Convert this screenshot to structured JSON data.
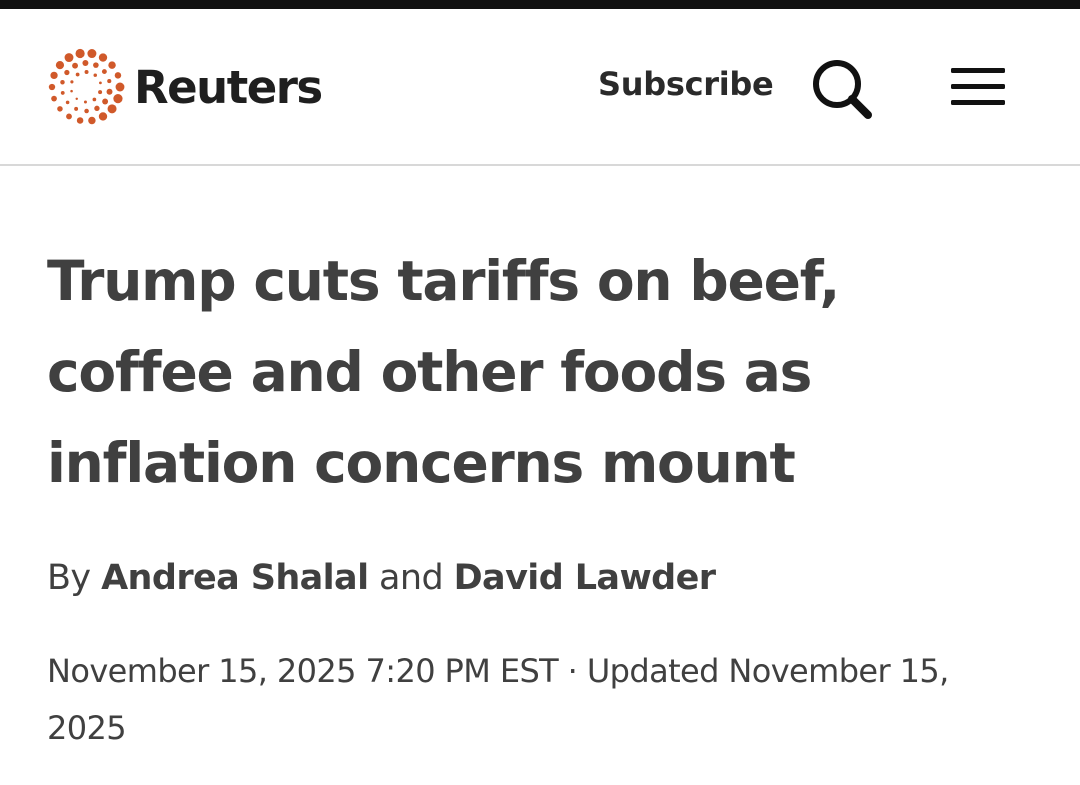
{
  "header": {
    "brand": "Reuters",
    "subscribe_label": "Subscribe",
    "icons": {
      "logo": "reuters-dot-ring-icon",
      "search": "search-icon",
      "menu": "hamburger-menu-icon"
    },
    "colors": {
      "brand_orange": "#d0592a",
      "text_dark": "#1f1f1f",
      "top_bar": "#111111"
    }
  },
  "article": {
    "headline": "Trump cuts tariffs on beef, coffee and other foods as inflation concerns mount",
    "byline": {
      "prefix": "By",
      "author_1": "Andrea Shalal",
      "conjunction": "and",
      "author_2": "David Lawder"
    },
    "dateline": "November 15, 2025 7:20 PM EST · Updated November 15, 2025"
  }
}
